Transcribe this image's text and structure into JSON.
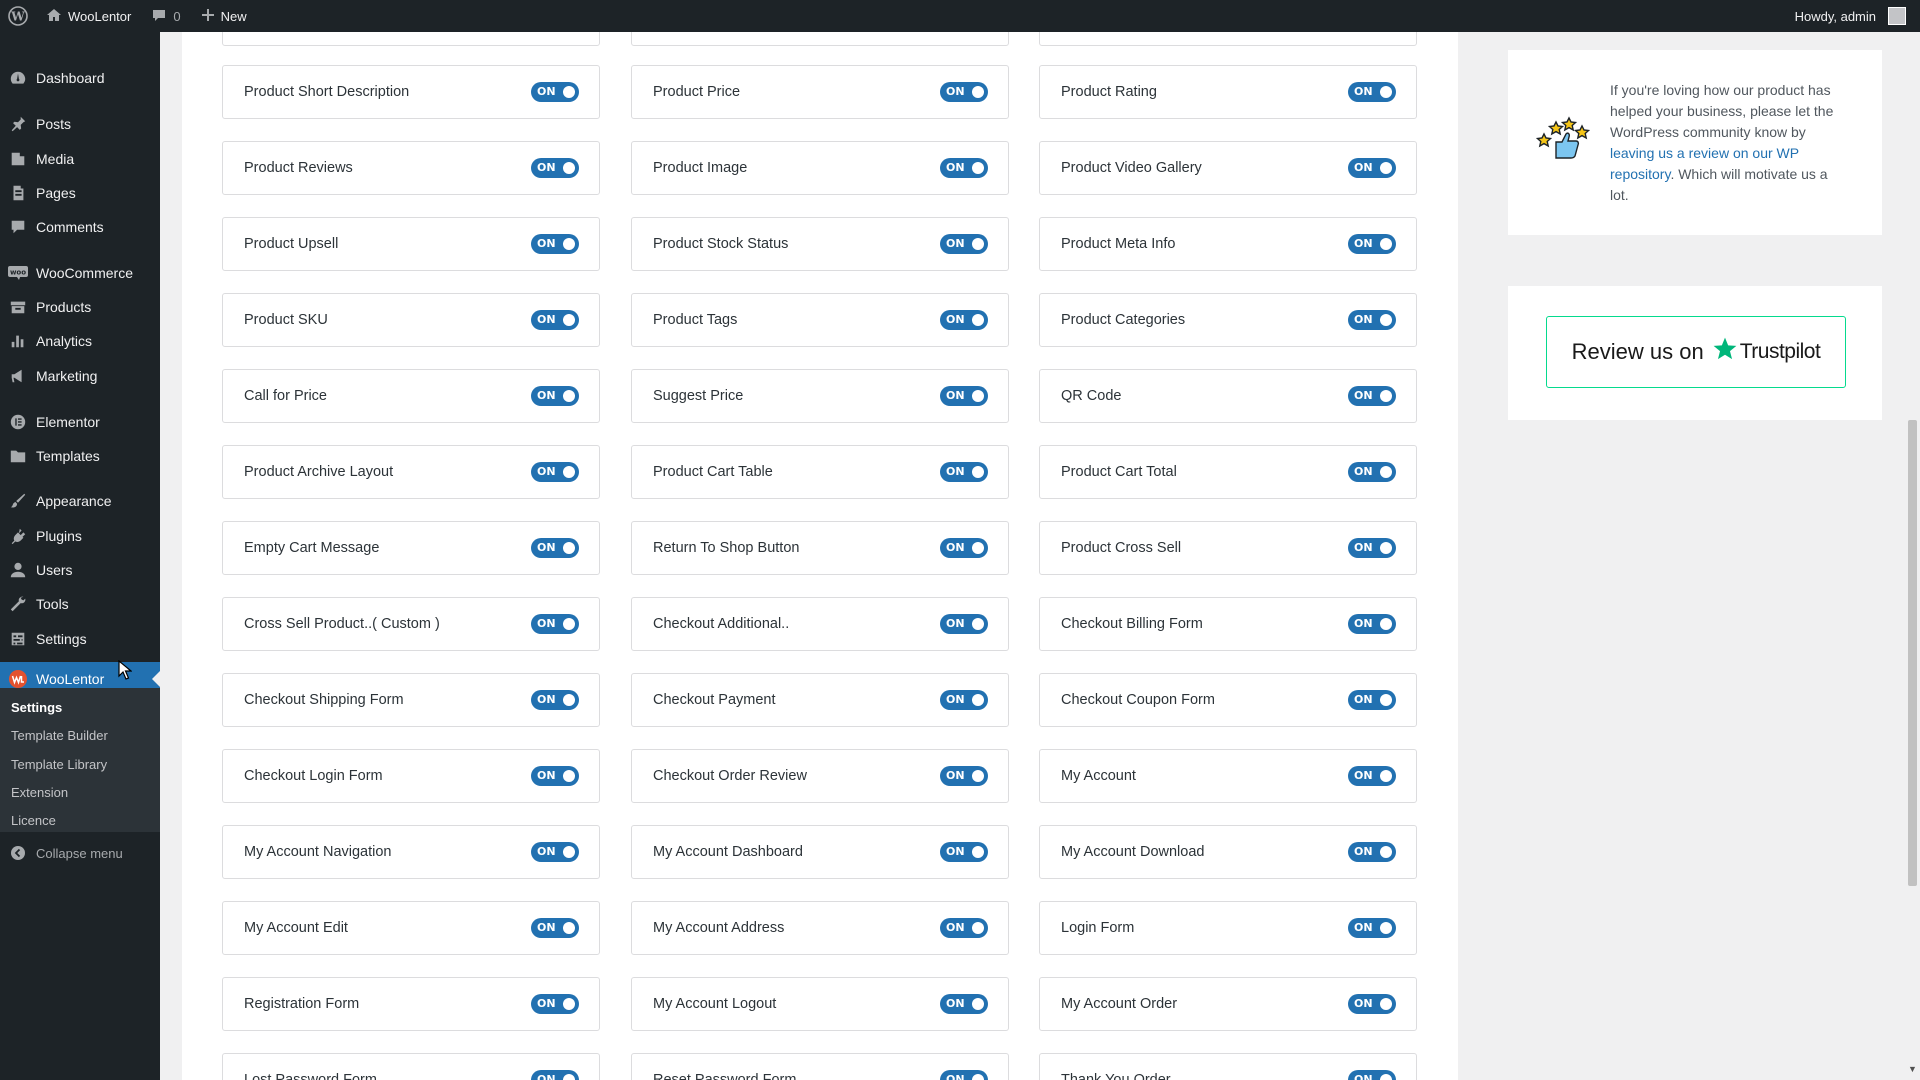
{
  "adminbar": {
    "site_name": "WooLentor",
    "comments_count": "0",
    "new_label": "New",
    "howdy": "Howdy, admin"
  },
  "sidebar": {
    "items": [
      {
        "label": "Dashboard",
        "icon": "dashboard-icon"
      },
      {
        "label": "Posts",
        "icon": "pin-icon"
      },
      {
        "label": "Media",
        "icon": "media-icon"
      },
      {
        "label": "Pages",
        "icon": "pages-icon"
      },
      {
        "label": "Comments",
        "icon": "comments-icon"
      },
      {
        "label": "WooCommerce",
        "icon": "woocommerce-icon"
      },
      {
        "label": "Products",
        "icon": "products-icon"
      },
      {
        "label": "Analytics",
        "icon": "analytics-icon"
      },
      {
        "label": "Marketing",
        "icon": "megaphone-icon"
      },
      {
        "label": "Elementor",
        "icon": "elementor-icon"
      },
      {
        "label": "Templates",
        "icon": "folder-icon"
      },
      {
        "label": "Appearance",
        "icon": "brush-icon"
      },
      {
        "label": "Plugins",
        "icon": "plugin-icon"
      },
      {
        "label": "Users",
        "icon": "user-icon"
      },
      {
        "label": "Tools",
        "icon": "wrench-icon"
      },
      {
        "label": "Settings",
        "icon": "settings-icon"
      },
      {
        "label": "WooLentor",
        "icon": "woolentor-icon"
      }
    ],
    "submenu": [
      "Settings",
      "Template Builder",
      "Template Library",
      "Extension",
      "Licence"
    ],
    "collapse_label": "Collapse menu"
  },
  "toggle_on_label": "ON",
  "modules": [
    {
      "label": "Product Short Description",
      "state": "ON"
    },
    {
      "label": "Product Price",
      "state": "ON"
    },
    {
      "label": "Product Rating",
      "state": "ON"
    },
    {
      "label": "Product Reviews",
      "state": "ON"
    },
    {
      "label": "Product Image",
      "state": "ON"
    },
    {
      "label": "Product Video Gallery",
      "state": "ON"
    },
    {
      "label": "Product Upsell",
      "state": "ON"
    },
    {
      "label": "Product Stock Status",
      "state": "ON"
    },
    {
      "label": "Product Meta Info",
      "state": "ON"
    },
    {
      "label": "Product SKU",
      "state": "ON"
    },
    {
      "label": "Product Tags",
      "state": "ON"
    },
    {
      "label": "Product Categories",
      "state": "ON"
    },
    {
      "label": "Call for Price",
      "state": "ON"
    },
    {
      "label": "Suggest Price",
      "state": "ON"
    },
    {
      "label": "QR Code",
      "state": "ON"
    },
    {
      "label": "Product Archive Layout",
      "state": "ON"
    },
    {
      "label": "Product Cart Table",
      "state": "ON"
    },
    {
      "label": "Product Cart Total",
      "state": "ON"
    },
    {
      "label": "Empty Cart Message",
      "state": "ON"
    },
    {
      "label": "Return To Shop Button",
      "state": "ON"
    },
    {
      "label": "Product Cross Sell",
      "state": "ON"
    },
    {
      "label": "Cross Sell Product..( Custom )",
      "state": "ON"
    },
    {
      "label": "Checkout Additional..",
      "state": "ON"
    },
    {
      "label": "Checkout Billing Form",
      "state": "ON"
    },
    {
      "label": "Checkout Shipping Form",
      "state": "ON"
    },
    {
      "label": "Checkout Payment",
      "state": "ON"
    },
    {
      "label": "Checkout Coupon Form",
      "state": "ON"
    },
    {
      "label": "Checkout Login Form",
      "state": "ON"
    },
    {
      "label": "Checkout Order Review",
      "state": "ON"
    },
    {
      "label": "My Account",
      "state": "ON"
    },
    {
      "label": "My Account Navigation",
      "state": "ON"
    },
    {
      "label": "My Account Dashboard",
      "state": "ON"
    },
    {
      "label": "My Account Download",
      "state": "ON"
    },
    {
      "label": "My Account Edit",
      "state": "ON"
    },
    {
      "label": "My Account Address",
      "state": "ON"
    },
    {
      "label": "Login Form",
      "state": "ON"
    },
    {
      "label": "Registration Form",
      "state": "ON"
    },
    {
      "label": "My Account Logout",
      "state": "ON"
    },
    {
      "label": "My Account Order",
      "state": "ON"
    },
    {
      "label": "Lost Password Form",
      "state": "ON"
    },
    {
      "label": "Reset Password Form",
      "state": "ON"
    },
    {
      "label": "Thank You Order",
      "state": "ON"
    }
  ],
  "review_widget": {
    "text_before": "If you're loving how our product has helped your business, please let the WordPress community know by ",
    "link_text": "leaving us a review on our WP repository",
    "text_after": ". Which will motivate us a lot."
  },
  "trustpilot": {
    "prefix": "Review us on",
    "brand": "Trustpilot",
    "brand_color": "#00b67a"
  },
  "colors": {
    "accent": "#2271b1",
    "adminbar_bg": "#1d2327",
    "page_bg": "#f0f0f1"
  }
}
